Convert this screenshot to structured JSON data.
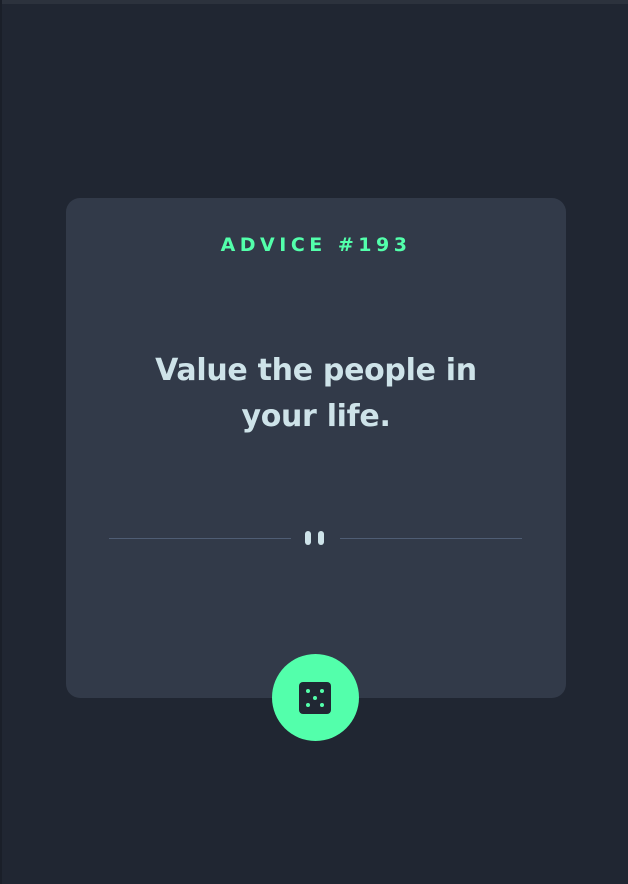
{
  "card": {
    "advice_id": "ADVICE #193",
    "advice_text": "Value the people in your life."
  },
  "divider": {
    "icon": "pause-icon"
  },
  "dice_button": {
    "icon": "dice-icon"
  },
  "colors": {
    "background": "#202632",
    "card": "#323a49",
    "accent": "#53ffab",
    "text": "#cee3e9",
    "divider": "#4f5d74"
  }
}
